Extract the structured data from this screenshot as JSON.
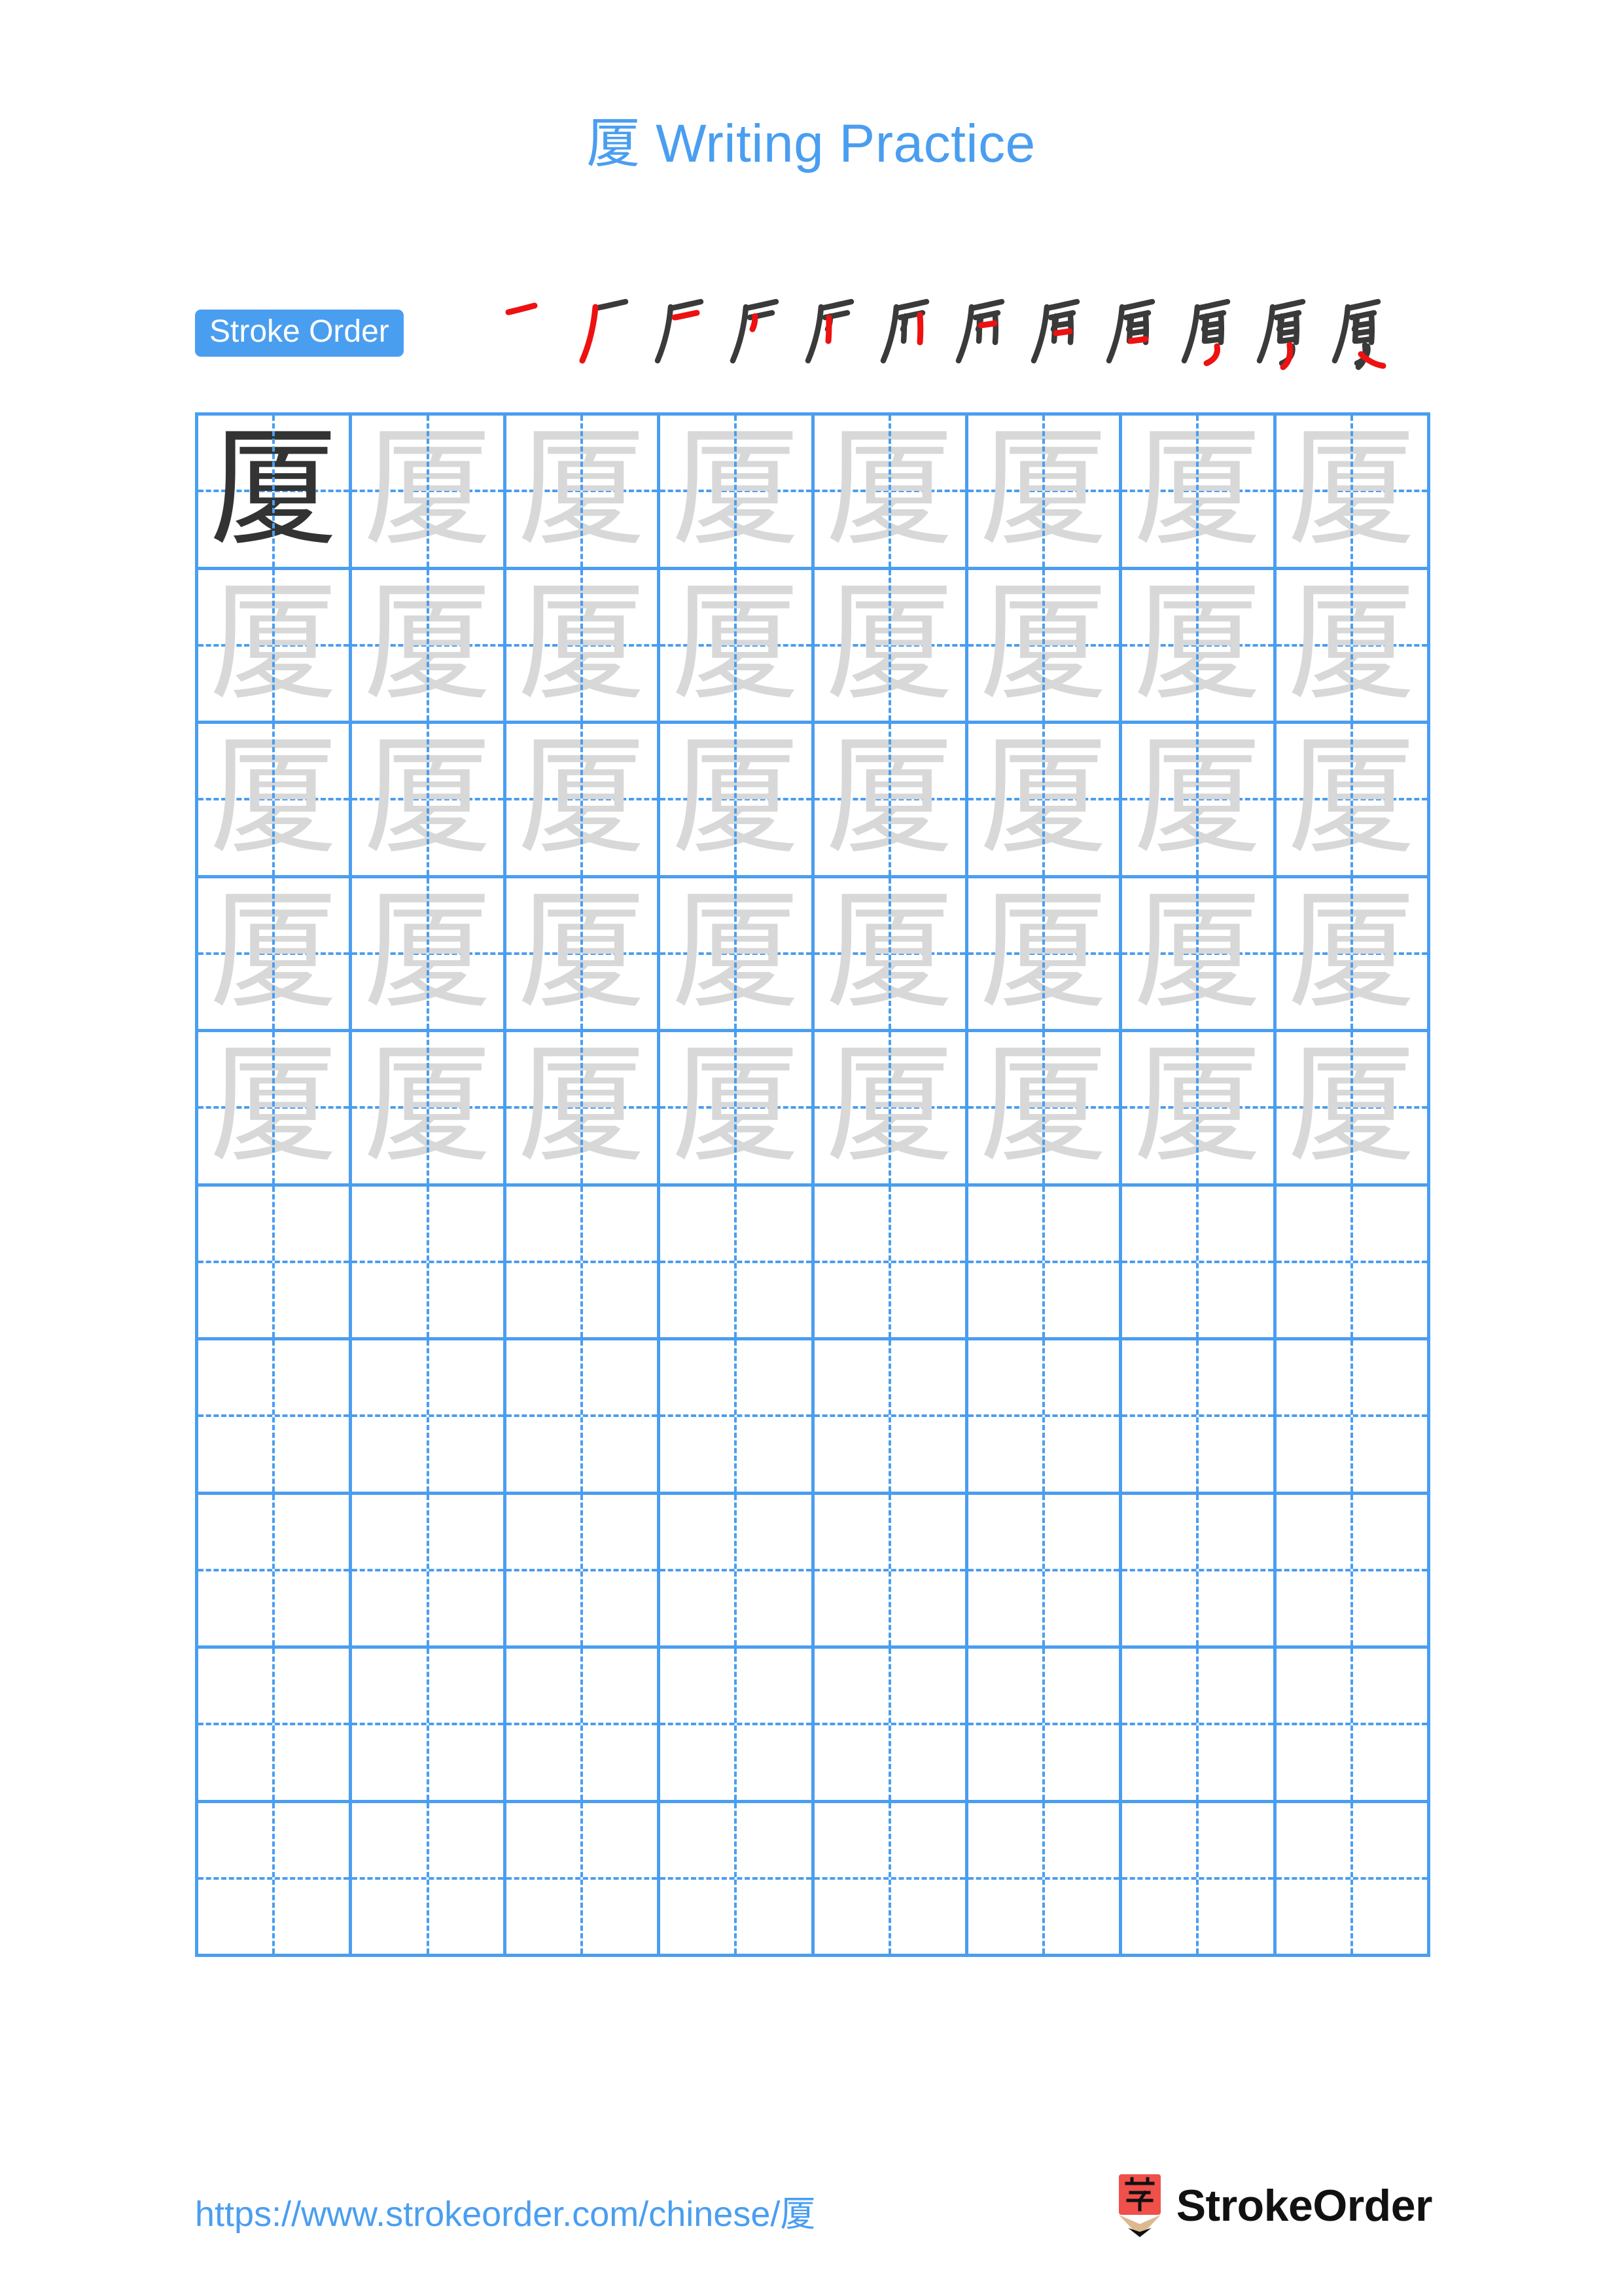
{
  "page": {
    "character": "厦",
    "title": "厦 Writing Practice",
    "title_character": "厦",
    "title_text": " Writing Practice",
    "accent_color": "#4a9ef0",
    "stroke_new_color": "#ee1111",
    "stroke_done_color": "#3a3a3a",
    "trace_gray_color": "#d8d8d8",
    "example_dark_color": "#333333"
  },
  "stroke_order": {
    "label": "Stroke Order",
    "total_strokes": 12,
    "steps": [
      {
        "index": 1,
        "cumulative_strokes": 1
      },
      {
        "index": 2,
        "cumulative_strokes": 2
      },
      {
        "index": 3,
        "cumulative_strokes": 3
      },
      {
        "index": 4,
        "cumulative_strokes": 4
      },
      {
        "index": 5,
        "cumulative_strokes": 5
      },
      {
        "index": 6,
        "cumulative_strokes": 6
      },
      {
        "index": 7,
        "cumulative_strokes": 7
      },
      {
        "index": 8,
        "cumulative_strokes": 8
      },
      {
        "index": 9,
        "cumulative_strokes": 9
      },
      {
        "index": 10,
        "cumulative_strokes": 10
      },
      {
        "index": 11,
        "cumulative_strokes": 11
      },
      {
        "index": 12,
        "cumulative_strokes": 12
      }
    ]
  },
  "grid": {
    "columns": 8,
    "rows": 10,
    "rows_data": [
      {
        "row": 1,
        "cells": [
          "厦",
          "厦",
          "厦",
          "厦",
          "厦",
          "厦",
          "厦",
          "厦"
        ],
        "first_cell_dark": true
      },
      {
        "row": 2,
        "cells": [
          "厦",
          "厦",
          "厦",
          "厦",
          "厦",
          "厦",
          "厦",
          "厦"
        ],
        "first_cell_dark": false
      },
      {
        "row": 3,
        "cells": [
          "厦",
          "厦",
          "厦",
          "厦",
          "厦",
          "厦",
          "厦",
          "厦"
        ],
        "first_cell_dark": false
      },
      {
        "row": 4,
        "cells": [
          "厦",
          "厦",
          "厦",
          "厦",
          "厦",
          "厦",
          "厦",
          "厦"
        ],
        "first_cell_dark": false
      },
      {
        "row": 5,
        "cells": [
          "厦",
          "厦",
          "厦",
          "厦",
          "厦",
          "厦",
          "厦",
          "厦"
        ],
        "first_cell_dark": false
      },
      {
        "row": 6,
        "cells": [
          "",
          "",
          "",
          "",
          "",
          "",
          "",
          ""
        ],
        "first_cell_dark": false
      },
      {
        "row": 7,
        "cells": [
          "",
          "",
          "",
          "",
          "",
          "",
          "",
          ""
        ],
        "first_cell_dark": false
      },
      {
        "row": 8,
        "cells": [
          "",
          "",
          "",
          "",
          "",
          "",
          "",
          ""
        ],
        "first_cell_dark": false
      },
      {
        "row": 9,
        "cells": [
          "",
          "",
          "",
          "",
          "",
          "",
          "",
          ""
        ],
        "first_cell_dark": false
      },
      {
        "row": 10,
        "cells": [
          "",
          "",
          "",
          "",
          "",
          "",
          "",
          ""
        ],
        "first_cell_dark": false
      }
    ]
  },
  "footer": {
    "url": "https://www.strokeorder.com/chinese/厦",
    "url_prefix": "https://www.strokeorder.com/chinese/",
    "url_character": "厦",
    "brand_name": "StrokeOrder",
    "brand_mark_character": "字",
    "brand_mark_color": "#f0504a",
    "brand_mark_wood_color": "#dcb98f"
  }
}
